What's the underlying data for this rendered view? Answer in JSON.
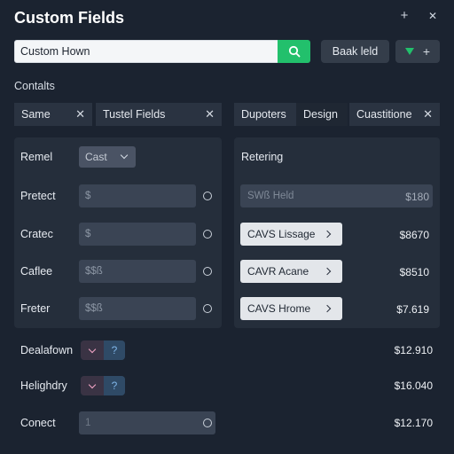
{
  "window": {
    "title": "Custom Fields",
    "add_icon": "+",
    "expand_icon": "✕"
  },
  "toolbar": {
    "search_value": "Custom Hown",
    "back_label": "Baak leld",
    "add_symbol": "+"
  },
  "section_label": "Contalts",
  "tabs_left": [
    {
      "label": "Same",
      "close": "✕"
    },
    {
      "label": "Tustel Fields",
      "close": "✕"
    }
  ],
  "tabs_right": [
    {
      "label": "Dupoters"
    },
    {
      "label": "Design"
    },
    {
      "label": "Cuastitione",
      "close": "✕"
    }
  ],
  "left_panel": {
    "header_label": "Remel",
    "select_value": "Cast",
    "rows": [
      {
        "label": "Pretect",
        "value": "$"
      },
      {
        "label": "Cratec",
        "value": "$"
      },
      {
        "label": "Caflee",
        "value": "$$ß"
      },
      {
        "label": "Freter",
        "value": "$$ß"
      }
    ]
  },
  "right_panel": {
    "header_label": "Retering",
    "field_label": "SWß Held",
    "field_amount": "$180",
    "items": [
      {
        "label": "CAVS Lissage",
        "amount": "$8670"
      },
      {
        "label": "CAVR Acane",
        "amount": "$8510"
      },
      {
        "label": "CAVS Hrome",
        "amount": "$7.619"
      }
    ]
  },
  "bottom_rows": [
    {
      "label": "Dealafown",
      "toggle_text": "?",
      "amount": "$12.910"
    },
    {
      "label": "Helighdry",
      "toggle_text": "?",
      "amount": "$16.040"
    },
    {
      "label": "Conect",
      "input_value": "1",
      "amount": "$12.170"
    }
  ]
}
